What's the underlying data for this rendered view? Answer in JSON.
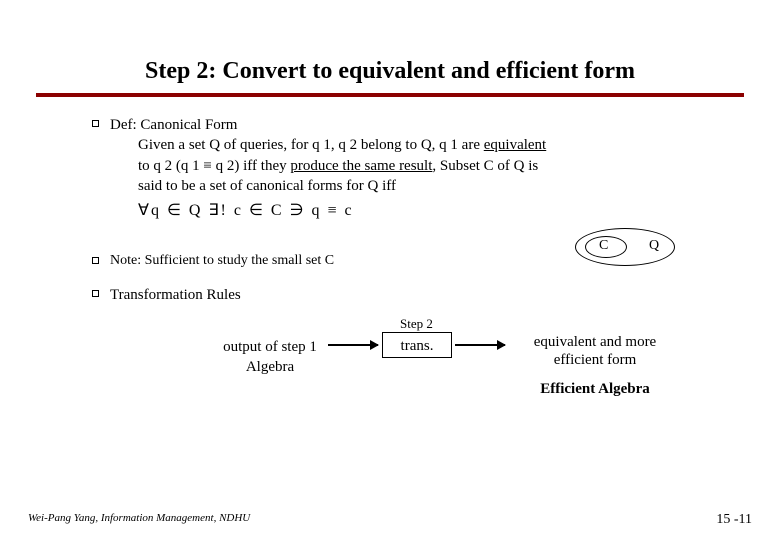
{
  "title": "Step 2: Convert to equivalent and efficient form",
  "bullet1": {
    "head": "Def: Canonical Form",
    "line1a": "Given a set Q of queries, for q 1, q 2 belong  to Q, q 1 are ",
    "line1b": "equivalent",
    "line2a": "to q 2 (q 1 ",
    "line2b": "≡",
    "line2c": " q 2) iff they ",
    "line2d": "produce the same result",
    "line2e": ", Subset C of Q is",
    "line3": "said to be a set of canonical forms for Q iff",
    "formula": "∀q ∈ Q  ∃!   c ∈ C  ∋  q ≡ c"
  },
  "diagram": {
    "c": "C",
    "q": "Q"
  },
  "bullet2": "Note: Sufficient to study the small set C",
  "bullet3": "Transformation Rules",
  "flow": {
    "step2": "Step 2",
    "output_line1": "output of step 1",
    "output_line2": "Algebra",
    "trans": "trans.",
    "equiv_line1": "equivalent and more",
    "equiv_line2": "efficient form",
    "eff": "Efficient Algebra"
  },
  "footer": {
    "left": "Wei-Pang Yang, Information Management, NDHU",
    "right": "15 -11"
  }
}
